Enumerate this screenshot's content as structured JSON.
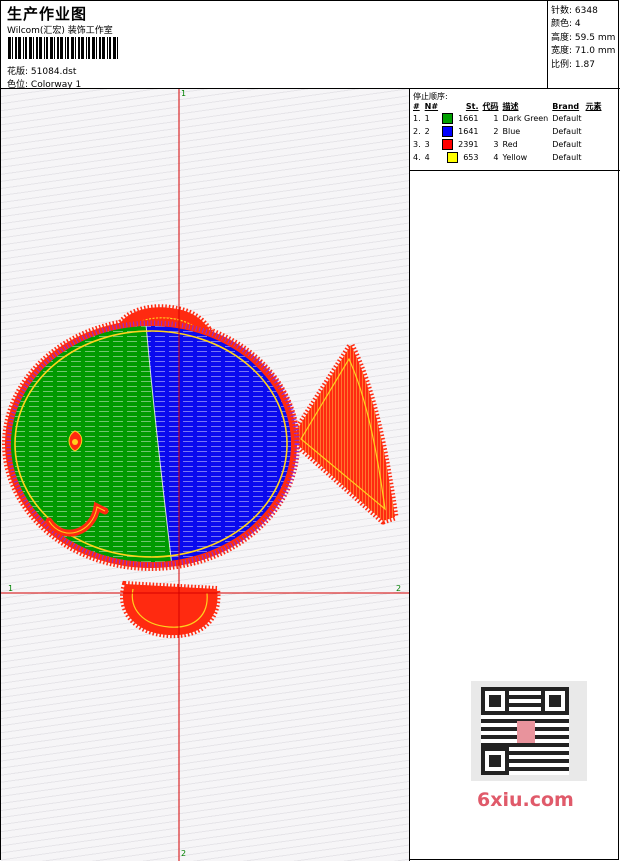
{
  "header": {
    "title": "生产作业图",
    "subtitle": "Wilcom(汇宏) 装饰工作室",
    "design_label": "花版:",
    "design_value": "51084.dst",
    "colorway_label": "色位:",
    "colorway_value": "Colorway 1"
  },
  "specs": {
    "stitches_label": "针数:",
    "stitches_value": "6348",
    "colors_label": "颜色:",
    "colors_value": "4",
    "height_label": "高度:",
    "height_value": "59.5 mm",
    "width_label": "宽度:",
    "width_value": "71.0 mm",
    "scale_label": "比例:",
    "scale_value": "1.87"
  },
  "legend": {
    "title": "停止顺序:",
    "columns": [
      "#",
      "N#",
      "St.",
      "代码",
      "描述",
      "Brand",
      "元素"
    ],
    "rows": [
      {
        "idx": "1.",
        "n": "1",
        "color": "#00a000",
        "st": "1661",
        "code": "1",
        "desc": "Dark Green",
        "brand": "Default"
      },
      {
        "idx": "2.",
        "n": "2",
        "color": "#0000ff",
        "st": "1641",
        "code": "2",
        "desc": "Blue",
        "brand": "Default"
      },
      {
        "idx": "3.",
        "n": "3",
        "color": "#ff0000",
        "st": "2391",
        "code": "3",
        "desc": "Red",
        "brand": "Default"
      },
      {
        "idx": "4.",
        "n": "4",
        "color": "#ffff00",
        "st": "653",
        "code": "4",
        "desc": "Yellow",
        "brand": "Default"
      }
    ]
  },
  "axes": {
    "v_top": "1",
    "v_bottom": "2",
    "h_left": "1",
    "h_right": "2"
  },
  "watermark": {
    "logo_text": "6xiu.com",
    "qr_icon": "qr-code-icon"
  },
  "colors": {
    "green": "#009a00",
    "blue": "#0a0aee",
    "red": "#ff2a10",
    "yellow": "#ffd21e",
    "purple": "#8a2be2",
    "guide": "#d40000"
  }
}
